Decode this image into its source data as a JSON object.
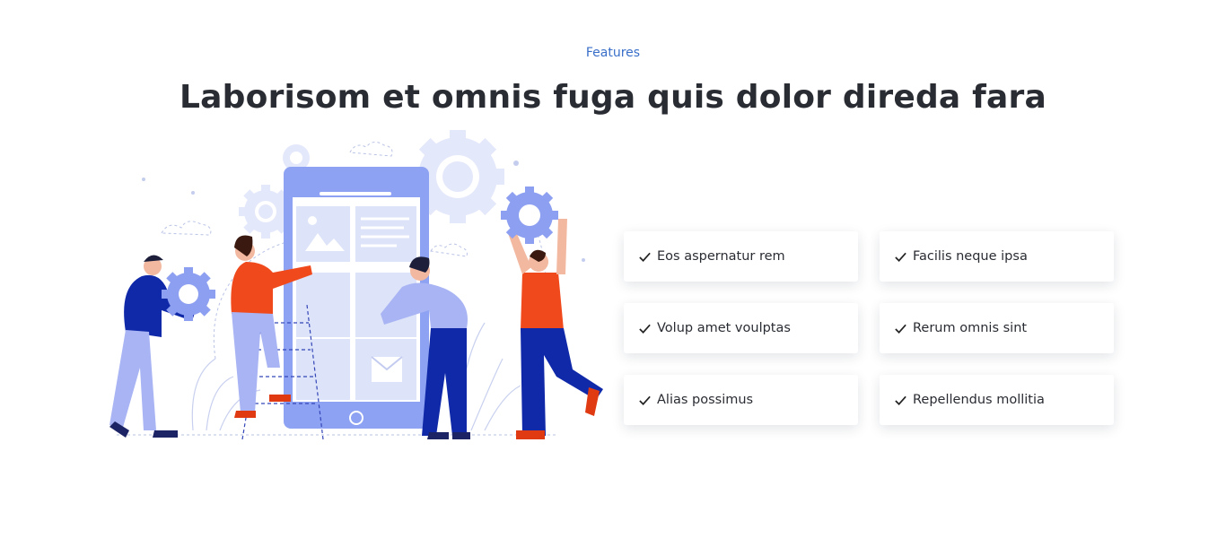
{
  "section": {
    "eyebrow": "Features",
    "title": "Laborisom et omnis fuga quis dolor direda fara"
  },
  "features": [
    {
      "label": "Eos aspernatur rem",
      "icon": "check-icon"
    },
    {
      "label": "Facilis neque ipsa",
      "icon": "check-icon"
    },
    {
      "label": "Volup amet voulptas",
      "icon": "check-icon"
    },
    {
      "label": "Rerum omnis sint",
      "icon": "check-icon"
    },
    {
      "label": "Alias possimus",
      "icon": "check-icon"
    },
    {
      "label": "Repellendus mollitia",
      "icon": "check-icon"
    }
  ],
  "colors": {
    "accent": "#3a6fc9",
    "heading": "#2a2c33",
    "illustration_primary": "#7e96f0",
    "illustration_light": "#dfe5fa",
    "illustration_orange": "#f0491c",
    "illustration_navy": "#1029a9"
  }
}
